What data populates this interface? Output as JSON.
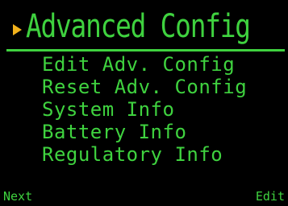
{
  "header": {
    "title": "Advanced Config",
    "cursor_icon": "triangle-pointer-icon",
    "cursor_color": "#f2b21c"
  },
  "menu": {
    "items": [
      {
        "label": "Edit Adv. Config"
      },
      {
        "label": "Reset Adv. Config"
      },
      {
        "label": "System Info"
      },
      {
        "label": "Battery Info"
      },
      {
        "label": "Regulatory Info"
      }
    ]
  },
  "softkeys": {
    "left_label": "Next",
    "right_label": "Edit"
  },
  "colors": {
    "background": "#000000",
    "text": "#3fd23f"
  }
}
